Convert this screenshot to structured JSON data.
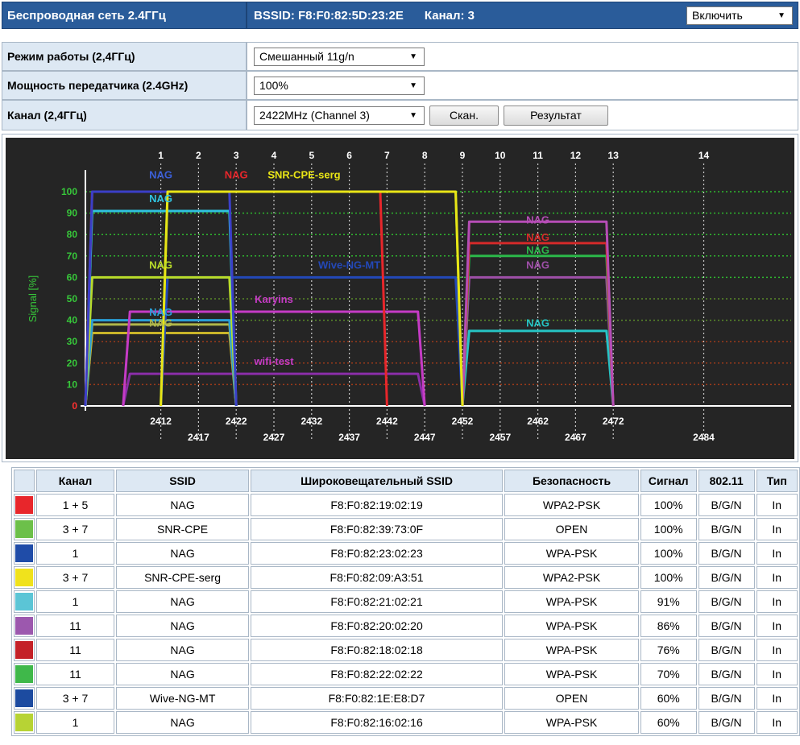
{
  "header": {
    "title": "Беспроводная сеть 2.4ГГц",
    "bssid": "BSSID: F8:F0:82:5D:23:2E",
    "channel": "Канал: 3",
    "enable_select": "Включить"
  },
  "settings": {
    "mode_label": "Режим работы (2,4ГГц)",
    "mode_value": "Смешанный 11g/n",
    "power_label": "Мощность передатчика (2.4GHz)",
    "power_value": "100%",
    "channel_label": "Канал (2,4ГГц)",
    "channel_value": "2422MHz (Channel 3)",
    "scan_button": "Скан.",
    "result_button": "Результат"
  },
  "chart_data": {
    "type": "area",
    "ylabel": "Signal [%]",
    "ylim": [
      0,
      100
    ],
    "yticks": [
      0,
      10,
      20,
      30,
      40,
      50,
      60,
      70,
      80,
      90,
      100
    ],
    "channels": [
      {
        "label": "1",
        "freq": 2412
      },
      {
        "label": "2",
        "freq": 2417
      },
      {
        "label": "3",
        "freq": 2422
      },
      {
        "label": "4",
        "freq": 2427
      },
      {
        "label": "5",
        "freq": 2432
      },
      {
        "label": "6",
        "freq": 2437
      },
      {
        "label": "7",
        "freq": 2442
      },
      {
        "label": "8",
        "freq": 2447
      },
      {
        "label": "9",
        "freq": 2452
      },
      {
        "label": "10",
        "freq": 2457
      },
      {
        "label": "11",
        "freq": 2462
      },
      {
        "label": "12",
        "freq": 2467
      },
      {
        "label": "13",
        "freq": 2472
      },
      {
        "label": "14",
        "freq": 2484
      }
    ],
    "freq_row1": [
      "2412",
      "2422",
      "2432",
      "2442",
      "2452",
      "2462",
      "2472"
    ],
    "freq_row2": [
      "2417",
      "2427",
      "2437",
      "2447",
      "2457",
      "2467",
      "2484"
    ],
    "series": [
      {
        "name": "NAG",
        "center": 2422,
        "width": 40,
        "signal": 100,
        "color": "#e8262b"
      },
      {
        "name": "SNR-CPE",
        "center": 2432,
        "width": 40,
        "signal": 100,
        "color": "#5cbf3a"
      },
      {
        "name": "NAG",
        "center": 2412,
        "width": 20,
        "signal": 100,
        "color": "#3b3fc8"
      },
      {
        "name": "SNR-CPE-serg",
        "center": 2432,
        "width": 40,
        "signal": 100,
        "color": "#e9e516"
      },
      {
        "name": "NAG",
        "center": 2412,
        "width": 20,
        "signal": 91,
        "color": "#30c2df"
      },
      {
        "name": "NAG",
        "center": 2462,
        "width": 20,
        "signal": 86,
        "color": "#b64db6"
      },
      {
        "name": "NAG",
        "center": 2462,
        "width": 20,
        "signal": 76,
        "color": "#d42a2a"
      },
      {
        "name": "NAG",
        "center": 2462,
        "width": 20,
        "signal": 70,
        "color": "#2bb84a"
      },
      {
        "name": "Wive-NG-MT",
        "center": 2432,
        "width": 40,
        "signal": 60,
        "color": "#2348b8"
      },
      {
        "name": "NAG",
        "center": 2412,
        "width": 20,
        "signal": 60,
        "color": "#b9dc2a"
      },
      {
        "name": "NAG",
        "center": 2462,
        "width": 20,
        "signal": 60,
        "color": "#9e4fa8"
      },
      {
        "name": "Karyins",
        "center": 2427,
        "width": 40,
        "signal": 44,
        "color": "#c53bc5"
      },
      {
        "name": "NAG",
        "center": 2412,
        "width": 20,
        "signal": 40,
        "color": "#2a9fd8"
      },
      {
        "name": "NAG",
        "center": 2412,
        "width": 20,
        "signal": 38,
        "color": "#b1b74a"
      },
      {
        "name": "NAG",
        "center": 2462,
        "width": 20,
        "signal": 35,
        "color": "#26c4c4"
      },
      {
        "name": "NAG",
        "center": 2412,
        "width": 20,
        "signal": 34,
        "color": "#c9b52a"
      },
      {
        "name": "wifi-test",
        "center": 2427,
        "width": 40,
        "signal": 15,
        "color": "#8a2ea8"
      }
    ],
    "labels": [
      {
        "text": "NAG",
        "freq": 2412,
        "y": 108,
        "color": "#3b5fd8"
      },
      {
        "text": "NAG",
        "freq": 2422,
        "y": 108,
        "color": "#e8262b"
      },
      {
        "text": "SNR-CPE-serg",
        "freq": 2431,
        "y": 108,
        "color": "#e9e516"
      },
      {
        "text": "NAG",
        "freq": 2412,
        "y": 97,
        "color": "#30c2df"
      },
      {
        "text": "NAG",
        "freq": 2462,
        "y": 87,
        "color": "#b64db6"
      },
      {
        "text": "NAG",
        "freq": 2462,
        "y": 79,
        "color": "#d42a2a"
      },
      {
        "text": "NAG",
        "freq": 2462,
        "y": 73,
        "color": "#2bb84a"
      },
      {
        "text": "NAG",
        "freq": 2412,
        "y": 66,
        "color": "#b9dc2a"
      },
      {
        "text": "Wive-NG-MT",
        "freq": 2437,
        "y": 66,
        "color": "#2348b8"
      },
      {
        "text": "NAG",
        "freq": 2462,
        "y": 66,
        "color": "#9e4fa8"
      },
      {
        "text": "Karyins",
        "freq": 2427,
        "y": 50,
        "color": "#c53bc5"
      },
      {
        "text": "NAG",
        "freq": 2412,
        "y": 44,
        "color": "#2a9fd8"
      },
      {
        "text": "NAG",
        "freq": 2412,
        "y": 39,
        "color": "#b1b74a"
      },
      {
        "text": "NAG",
        "freq": 2462,
        "y": 39,
        "color": "#26c4c4"
      },
      {
        "text": "wifi-test",
        "freq": 2427,
        "y": 21,
        "color": "#c53bc5"
      }
    ]
  },
  "table": {
    "headers": [
      "",
      "Канал",
      "SSID",
      "Широковещательный SSID",
      "Безопасность",
      "Сигнал",
      "802.11",
      "Тип"
    ],
    "rows": [
      {
        "color": "#e8262b",
        "channel": "1 + 5",
        "ssid": "NAG",
        "bssid": "F8:F0:82:19:02:19",
        "security": "WPA2-PSK",
        "signal": "100%",
        "mode": "B/G/N",
        "type": "In"
      },
      {
        "color": "#6cc04a",
        "channel": "3 + 7",
        "ssid": "SNR-CPE",
        "bssid": "F8:F0:82:39:73:0F",
        "security": "OPEN",
        "signal": "100%",
        "mode": "B/G/N",
        "type": "In"
      },
      {
        "color": "#1f4ca8",
        "channel": "1",
        "ssid": "NAG",
        "bssid": "F8:F0:82:23:02:23",
        "security": "WPA-PSK",
        "signal": "100%",
        "mode": "B/G/N",
        "type": "In"
      },
      {
        "color": "#f0e21c",
        "channel": "3 + 7",
        "ssid": "SNR-CPE-serg",
        "bssid": "F8:F0:82:09:A3:51",
        "security": "WPA2-PSK",
        "signal": "100%",
        "mode": "B/G/N",
        "type": "In"
      },
      {
        "color": "#5bc5d6",
        "channel": "1",
        "ssid": "NAG",
        "bssid": "F8:F0:82:21:02:21",
        "security": "WPA-PSK",
        "signal": "91%",
        "mode": "B/G/N",
        "type": "In"
      },
      {
        "color": "#9c58ae",
        "channel": "11",
        "ssid": "NAG",
        "bssid": "F8:F0:82:20:02:20",
        "security": "WPA-PSK",
        "signal": "86%",
        "mode": "B/G/N",
        "type": "In"
      },
      {
        "color": "#c42128",
        "channel": "11",
        "ssid": "NAG",
        "bssid": "F8:F0:82:18:02:18",
        "security": "WPA-PSK",
        "signal": "76%",
        "mode": "B/G/N",
        "type": "In"
      },
      {
        "color": "#3fb84a",
        "channel": "11",
        "ssid": "NAG",
        "bssid": "F8:F0:82:22:02:22",
        "security": "WPA-PSK",
        "signal": "70%",
        "mode": "B/G/N",
        "type": "In"
      },
      {
        "color": "#1c4ba0",
        "channel": "3 + 7",
        "ssid": "Wive-NG-MT",
        "bssid": "F8:F0:82:1E:E8:D7",
        "security": "OPEN",
        "signal": "60%",
        "mode": "B/G/N",
        "type": "In"
      },
      {
        "color": "#b7d334",
        "channel": "1",
        "ssid": "NAG",
        "bssid": "F8:F0:82:16:02:16",
        "security": "WPA-PSK",
        "signal": "60%",
        "mode": "B/G/N",
        "type": "In"
      }
    ]
  }
}
